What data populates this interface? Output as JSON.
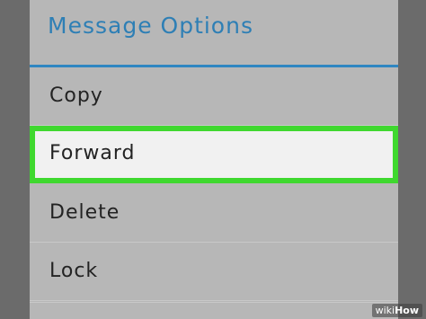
{
  "dialog": {
    "title": "Message Options",
    "items": [
      {
        "label": "Copy"
      },
      {
        "label": "Forward"
      },
      {
        "label": "Delete"
      },
      {
        "label": "Lock"
      }
    ]
  },
  "watermark": {
    "prefix": "wiki",
    "suffix": "How"
  },
  "colors": {
    "accent": "#2e7fb5",
    "highlight": "#3fd82f",
    "dialog_bg": "#b7b7b7"
  }
}
